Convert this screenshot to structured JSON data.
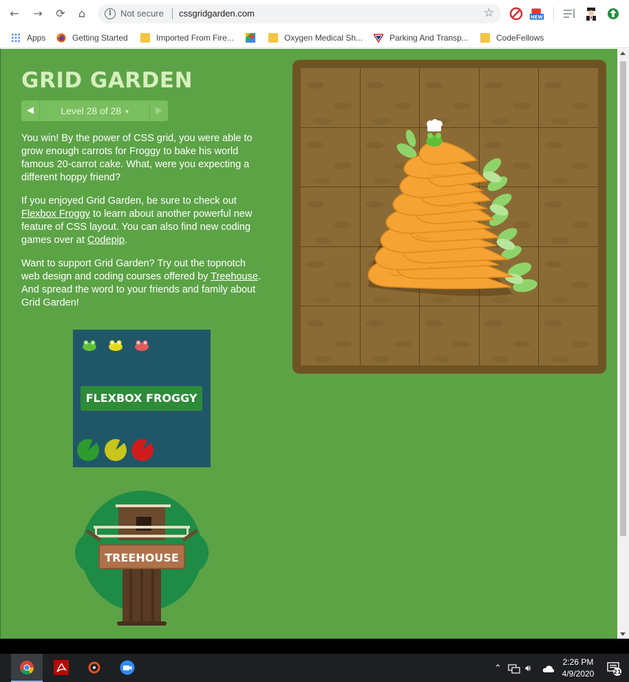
{
  "browser": {
    "security_label": "Not secure",
    "url": "cssgridgarden.com",
    "extension_badge": "NEW"
  },
  "bookmarks": [
    {
      "label": "Apps",
      "icon": "apps-grid-icon"
    },
    {
      "label": "Getting Started",
      "icon": "firefox-icon"
    },
    {
      "label": "Imported From Fire...",
      "icon": "folder-icon"
    },
    {
      "label": "",
      "icon": "google-maps-icon"
    },
    {
      "label": "Oxygen Medical Sh...",
      "icon": "folder-icon"
    },
    {
      "label": "Parking And Transp...",
      "icon": "parking-icon"
    },
    {
      "label": "CodeFellows",
      "icon": "folder-icon"
    }
  ],
  "game": {
    "title": "GRID GARDEN",
    "level_label": "Level 28 of 28",
    "prev_arrow": "◀",
    "next_arrow": "▶",
    "caret": "▾",
    "paragraph1": "You win! By the power of CSS grid, you were able to grow enough carrots for Froggy to bake his world famous 20-carrot cake. What, were you expecting a different hoppy friend?",
    "paragraph2_before": "If you enjoyed Grid Garden, be sure to check out ",
    "paragraph2_link": "Flexbox Froggy",
    "paragraph2_middle": " to learn about another powerful new feature of CSS layout. You can also find new coding games over at ",
    "paragraph2_link2": "Codepip",
    "paragraph2_after": ".",
    "paragraph3_before": "Want to support Grid Garden? Try out the topnotch web design and coding courses offered by ",
    "paragraph3_link": "Treehouse",
    "paragraph3_after": ". And spread the word to your friends and family about Grid Garden!",
    "froggy_button": "FLEXBOX FROGGY",
    "treehouse_button": "TREEHOUSE"
  },
  "colors": {
    "page_bg": "#5ca346",
    "title": "#d6efbe",
    "garden_border": "#6e5422",
    "soil": "#8b6b35",
    "carrot": "#f5a334",
    "carrot_top": "#8fd46a",
    "froggy_card": "#1f5768"
  },
  "taskbar": {
    "time": "2:26 PM",
    "date": "4/9/2020",
    "notification_count": "21"
  }
}
